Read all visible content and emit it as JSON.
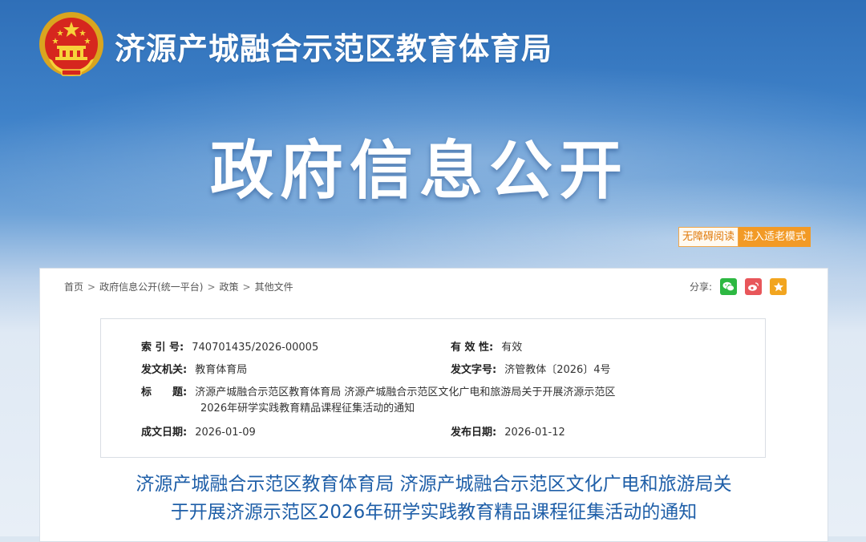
{
  "header": {
    "site_title": "济源产城融合示范区教育体育局",
    "big_title": "政府信息公开"
  },
  "accessibility": {
    "barrier_free": "无障碍阅读",
    "elder_mode": "进入适老模式"
  },
  "breadcrumb": {
    "items": [
      "首页",
      "政府信息公开(统一平台)",
      "政策",
      "其他文件"
    ],
    "separator": ">"
  },
  "share": {
    "label": "分享:",
    "icons": [
      "wechat-icon",
      "weibo-icon",
      "favorite-icon"
    ],
    "colors": {
      "wechat": "#2db842",
      "weibo": "#e8565a",
      "favorite": "#f2a51f"
    }
  },
  "meta": {
    "index_label": "索 引 号:",
    "index_value": "740701435/2026-00005",
    "validity_label": "有 效 性:",
    "validity_value": "有效",
    "issuer_label": "发文机关:",
    "issuer_value": "教育体育局",
    "doc_no_label": "发文字号:",
    "doc_no_value": "济管教体〔2026〕4号",
    "title_label": "标　　题:",
    "title_line1": "济源产城融合示范区教育体育局 济源产城融合示范区文化广电和旅游局关于开展济源示范区",
    "title_line2": "2026年研学实践教育精品课程征集活动的通知",
    "created_label": "成文日期:",
    "created_value": "2026-01-09",
    "published_label": "发布日期:",
    "published_value": "2026-01-12"
  },
  "document": {
    "title_line1": "济源产城融合示范区教育体育局 济源产城融合示范区文化广电和旅游局关",
    "title_line2": "于开展济源示范区2026年研学实践教育精品课程征集活动的通知"
  },
  "colors": {
    "accent_blue": "#1f5fa8",
    "banner_blue": "#3f82c9",
    "orange": "#f29a26"
  }
}
